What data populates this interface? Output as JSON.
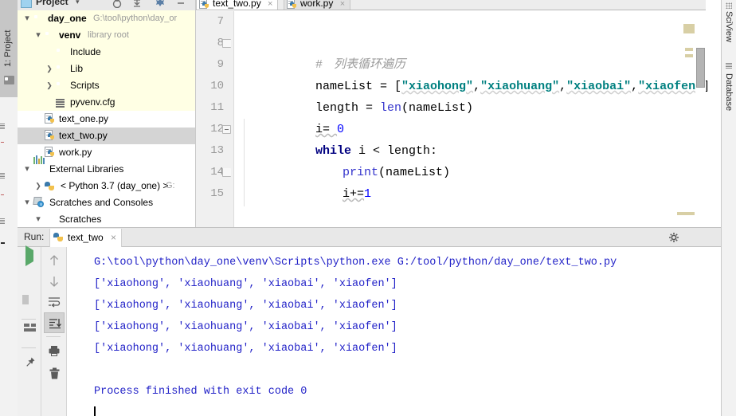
{
  "window": {
    "left_tool_tab": "1: Project",
    "right_tool_tabs": [
      "SciView",
      "Database"
    ]
  },
  "project_panel": {
    "title": "Project",
    "caret": "▾",
    "icons": [
      "target-icon",
      "collapse-all-icon",
      "settings-icon",
      "hide-icon"
    ],
    "tree": [
      {
        "label": "day_one",
        "secondary": "G:\\tool\\python\\day_or",
        "icon": "folder-icon",
        "arrow": "down",
        "depth": 0,
        "bold": true,
        "highlight": "venv"
      },
      {
        "label": "venv",
        "secondary": "library root",
        "icon": "folder-icon",
        "arrow": "down",
        "depth": 1,
        "bold": false,
        "highlight": "venv"
      },
      {
        "label": "Include",
        "secondary": "",
        "icon": "folder-icon",
        "arrow": "none",
        "depth": 2,
        "bold": false,
        "highlight": "venv"
      },
      {
        "label": "Lib",
        "secondary": "",
        "icon": "folder-icon",
        "arrow": "right",
        "depth": 2,
        "bold": false,
        "highlight": "venv"
      },
      {
        "label": "Scripts",
        "secondary": "",
        "icon": "folder-icon",
        "arrow": "right",
        "depth": 2,
        "bold": false,
        "highlight": "venv"
      },
      {
        "label": "pyvenv.cfg",
        "secondary": "",
        "icon": "cfg-file-icon",
        "arrow": "none",
        "depth": 2,
        "bold": false,
        "highlight": "venv"
      },
      {
        "label": "text_one.py",
        "secondary": "",
        "icon": "python-file-icon",
        "arrow": "none",
        "depth": 1,
        "bold": false,
        "highlight": "none"
      },
      {
        "label": "text_two.py",
        "secondary": "",
        "icon": "python-file-icon",
        "arrow": "none",
        "depth": 1,
        "bold": false,
        "highlight": "selected"
      },
      {
        "label": "work.py",
        "secondary": "",
        "icon": "python-file-icon",
        "arrow": "none",
        "depth": 1,
        "bold": false,
        "highlight": "none"
      },
      {
        "label": "External Libraries",
        "secondary": "",
        "icon": "libraries-icon",
        "arrow": "down",
        "depth": 0,
        "bold": false,
        "highlight": "none"
      },
      {
        "label": "< Python 3.7 (day_one) >",
        "secondary": "G:",
        "icon": "python-sdk-icon",
        "arrow": "right",
        "depth": 1,
        "bold": false,
        "highlight": "none"
      },
      {
        "label": "Scratches and Consoles",
        "secondary": "",
        "icon": "scratches-icon",
        "arrow": "down",
        "depth": 0,
        "bold": false,
        "highlight": "none"
      },
      {
        "label": "Scratches",
        "secondary": "",
        "icon": "folder-icon",
        "arrow": "down",
        "depth": 1,
        "bold": false,
        "highlight": "none"
      }
    ]
  },
  "editor": {
    "tabs": [
      {
        "label": "text_two.py",
        "icon": "python-file-icon",
        "close": "×",
        "active": true
      },
      {
        "label": "work.py",
        "icon": "python-file-icon",
        "close": "×",
        "active": false
      }
    ],
    "line_numbers": [
      "7",
      "8",
      "9",
      "10",
      "11",
      "12",
      "13",
      "14",
      "15"
    ],
    "code": {
      "l8_hash": "#",
      "l8_comment": "列表循环遍历",
      "l9_a": "nameList = [",
      "l9_s1": "\"xiaohong\"",
      "l9_c1": ",",
      "l9_s2": "\"xiaohuang\"",
      "l9_c2": ",",
      "l9_s3": "\"xiaobai\"",
      "l9_c3": ",",
      "l9_s4": "\"xiaofen\"",
      "l9_b": "]",
      "l10_a": "length = ",
      "l10_fn": "len",
      "l10_b": "(nameList)",
      "l11_a": "i= ",
      "l11_n": "0",
      "l12_kw": "while",
      "l12_rest": " i < length:",
      "l13_fn": "print",
      "l13_rest": "(nameList)",
      "l14_a": "i+=",
      "l14_n": "1"
    }
  },
  "run_panel": {
    "label": "Run:",
    "tab_label": "text_two",
    "tab_close": "×",
    "header_buttons": [
      "gear-icon",
      "minimize-icon"
    ],
    "left_toolbar": [
      "run-icon",
      "stop-icon",
      "pause-icon",
      "layout-icon",
      "pin-icon"
    ],
    "right_toolbar": [
      "scroll-up-icon",
      "scroll-down-icon",
      "soft-wrap-icon",
      "scroll-to-end-icon",
      "print-icon",
      "trash-icon"
    ],
    "console_lines": [
      "G:\\tool\\python\\day_one\\venv\\Scripts\\python.exe G:/tool/python/day_one/text_two.py",
      "['xiaohong', 'xiaohuang', 'xiaobai', 'xiaofen']",
      "['xiaohong', 'xiaohuang', 'xiaobai', 'xiaofen']",
      "['xiaohong', 'xiaohuang', 'xiaobai', 'xiaofen']",
      "['xiaohong', 'xiaohuang', 'xiaobai', 'xiaofen']",
      "",
      "Process finished with exit code 0"
    ]
  },
  "colors": {
    "accent_green": "#59a869",
    "console_text": "#2323c8",
    "keyword": "#000080",
    "string": "#008080",
    "comment": "#9b9b9b",
    "selection": "#d4d4d4",
    "venv_highlight": "#ffffe4"
  }
}
